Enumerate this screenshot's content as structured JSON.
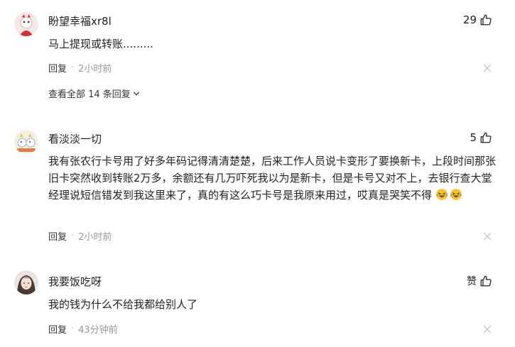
{
  "comments": [
    {
      "username": "盼望幸福xr8l",
      "likes": "29",
      "content": "马上提现或转账.........",
      "reply_label": "回复",
      "separator": "·",
      "time": "2小时前",
      "view_all": "查看全部 14 条回复"
    },
    {
      "username": "看淡淡一切",
      "likes": "5",
      "content": "我有张农行卡号用了好多年码记得清清楚楚，后来工作人员说卡变形了要换新卡，上段时间那张旧卡突然收到转账2万多，余额还有几万吓死我以为是新卡，但是卡号又对不上，去银行查大堂经理说短信错发到我这里来了，真的有这么巧卡号是我原来用过，哎真是哭笑不得",
      "emojis": [
        "laugh-cry-emoji",
        "laugh-cry-emoji"
      ],
      "reply_label": "回复",
      "separator": "·",
      "time": "2小时前"
    },
    {
      "username": "我要饭吃呀",
      "likes": "赞",
      "content": "我的钱为什么不给我都给别人了",
      "reply_label": "回复",
      "separator": "·",
      "time": "43分钟前"
    }
  ],
  "icons": {
    "like": "thumbs-up-icon",
    "close": "close-icon",
    "expand": "chevron-down-icon"
  },
  "colors": {
    "text": "#222222",
    "muted": "#999999",
    "icon": "#c8c8c8"
  }
}
